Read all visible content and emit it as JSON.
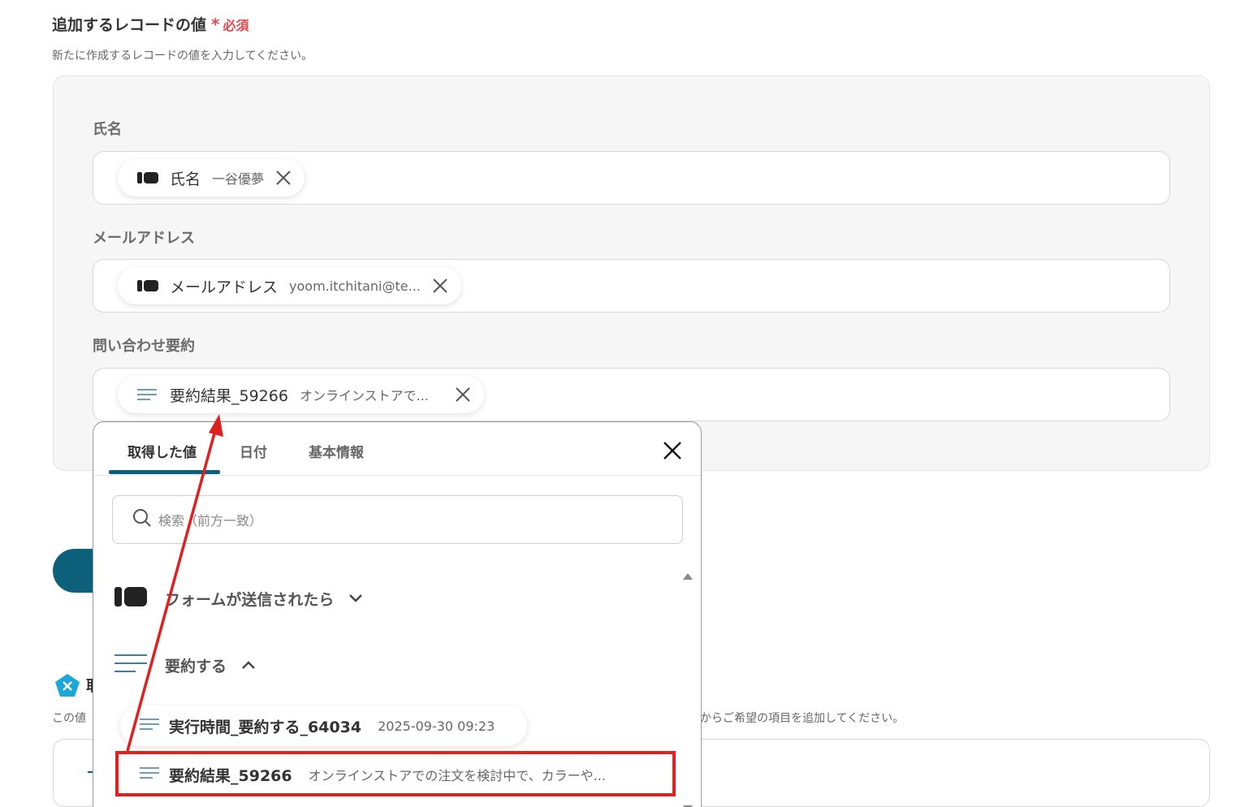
{
  "section": {
    "title": "追加するレコードの値",
    "required_mark": "*",
    "required_text": "必須",
    "description": "新たに作成するレコードの値を入力してください。"
  },
  "fields": [
    {
      "label": "氏名",
      "chip_key": "氏名",
      "chip_value": "一谷優夢",
      "chip_icon": "form-icon"
    },
    {
      "label": "メールアドレス",
      "chip_key": "メールアドレス",
      "chip_value": "yoom.itchitani@te...",
      "chip_icon": "form-icon"
    },
    {
      "label": "問い合わせ要約",
      "chip_key": "要約結果_59266",
      "chip_value": "オンラインストアで...",
      "chip_icon": "text-lines-icon"
    }
  ],
  "popup": {
    "tabs": [
      "取得した値",
      "日付",
      "基本情報"
    ],
    "active_tab": "取得した値",
    "search_placeholder": "検索（前方一致）",
    "groups": [
      {
        "label": "フォームが送信されたら",
        "icon": "form-icon",
        "expanded": false
      },
      {
        "label": "要約する",
        "icon": "text-lines-icon",
        "expanded": true
      }
    ],
    "items": [
      {
        "key": "実行時間_要約する_64034",
        "value": "2025-09-30 09:23"
      },
      {
        "key": "要約結果_59266",
        "value": "オンラインストアでの注文を検討中で、カラーや..."
      }
    ]
  },
  "below": {
    "title_fragment": "取",
    "desc_left": "この値",
    "desc_right": "からご希望の項目を追加してください。"
  },
  "colors": {
    "accent": "#0d6079",
    "required": "#e5484d",
    "highlight": "#e02020",
    "panel_bg": "#f6f6f7"
  }
}
